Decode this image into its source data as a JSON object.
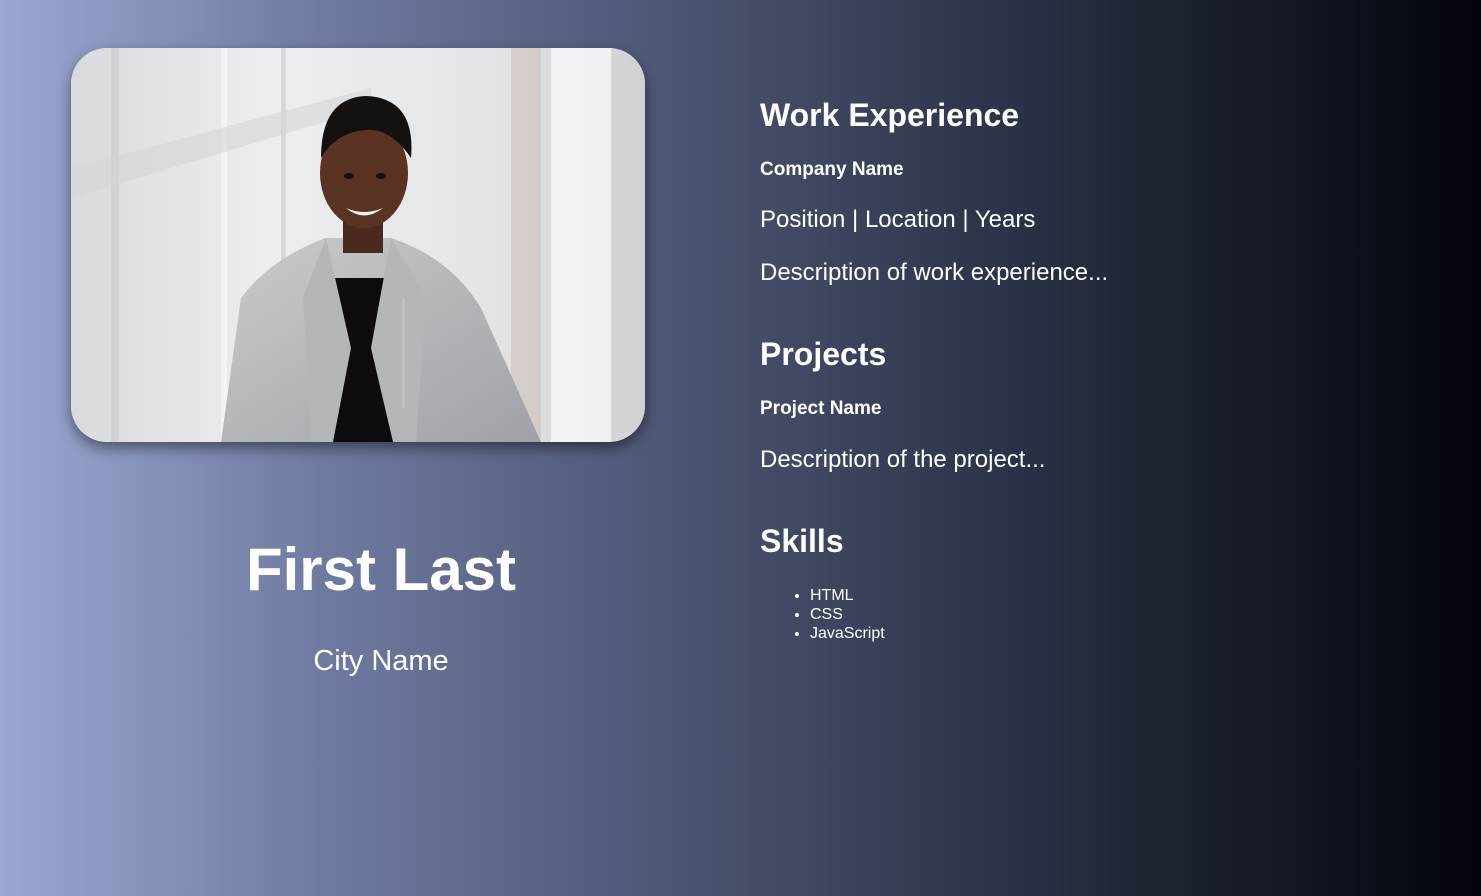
{
  "profile": {
    "name": "First Last",
    "city": "City Name",
    "photo_icon": "profile-photo"
  },
  "work_experience": {
    "title": "Work Experience",
    "company": "Company Name",
    "details": "Position | Location | Years",
    "description": "Description of work experience..."
  },
  "projects": {
    "title": "Projects",
    "project_name": "Project Name",
    "description": "Description of the project..."
  },
  "skills": {
    "title": "Skills",
    "items": [
      "HTML",
      "CSS",
      "JavaScript"
    ]
  },
  "colors": {
    "text": "#ffffff",
    "gradient_start": "#9aa8d2",
    "gradient_end": "#01040a"
  }
}
